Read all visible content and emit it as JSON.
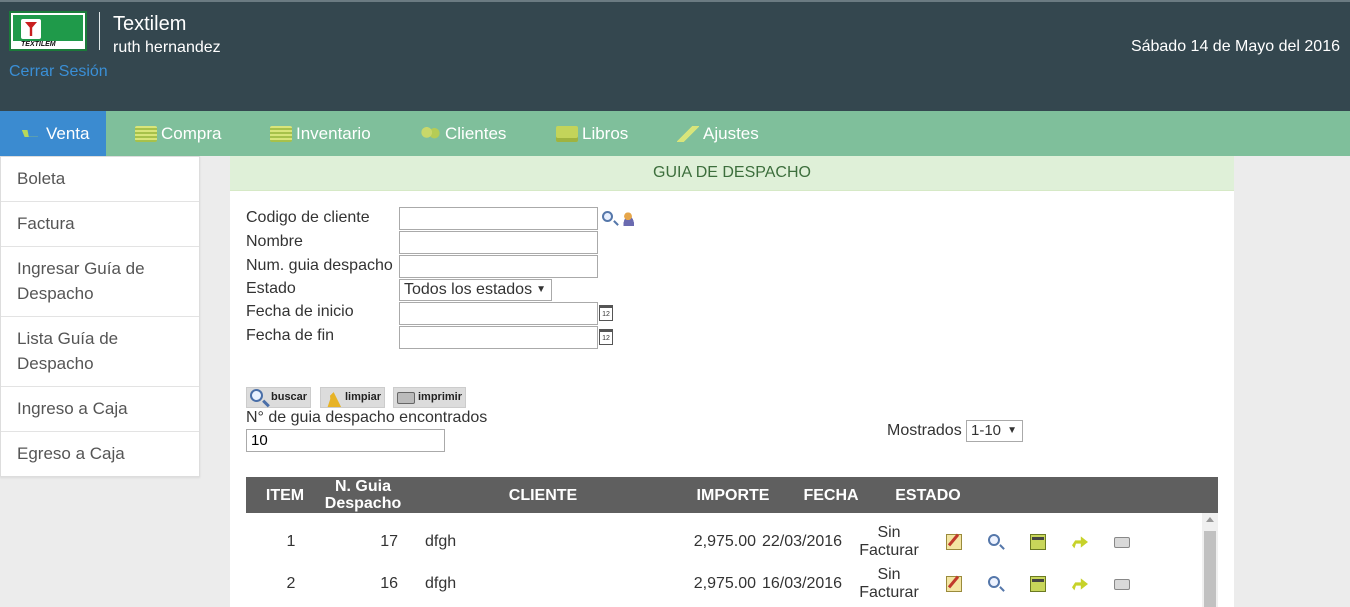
{
  "header": {
    "logo_text": "TEXTILEM",
    "app_title": "Textilem",
    "user_name": "ruth hernandez",
    "logout_label": "Cerrar Sesión",
    "date": "Sábado 14 de Mayo del 2016"
  },
  "nav": {
    "items": [
      {
        "label": "Venta",
        "icon": "cart-icon",
        "active": true
      },
      {
        "label": "Compra",
        "icon": "list-icon"
      },
      {
        "label": "Inventario",
        "icon": "list-icon"
      },
      {
        "label": "Clientes",
        "icon": "users-icon"
      },
      {
        "label": "Libros",
        "icon": "books-icon"
      },
      {
        "label": "Ajustes",
        "icon": "tools-icon"
      }
    ]
  },
  "sidebar": {
    "items": [
      {
        "label": "Boleta"
      },
      {
        "label": "Factura"
      },
      {
        "label": "Ingresar Guía de Despacho"
      },
      {
        "label": "Lista Guía de Despacho"
      },
      {
        "label": "Ingreso a Caja"
      },
      {
        "label": "Egreso a Caja"
      }
    ]
  },
  "panel": {
    "title": "GUIA DE DESPACHO"
  },
  "form": {
    "client_code_label": "Codigo de cliente",
    "client_code_value": "",
    "name_label": "Nombre",
    "name_value": "",
    "guide_num_label": "Num. guia despacho",
    "guide_num_value": "",
    "status_label": "Estado",
    "status_value": "Todos los estados",
    "start_date_label": "Fecha de inicio",
    "start_date_value": "",
    "end_date_label": "Fecha de fin",
    "end_date_value": "",
    "calendar_icon_text": "12"
  },
  "actions": {
    "search_label": "buscar",
    "clear_label": "limpiar",
    "print_label": "imprimir"
  },
  "results": {
    "found_label": "N° de guia despacho encontrados",
    "found_value": "10",
    "shown_label": "Mostrados",
    "shown_value": "1-10"
  },
  "table": {
    "headers": {
      "item": "ITEM",
      "guide": "N. Guia Despacho",
      "client": "CLIENTE",
      "amount": "IMPORTE",
      "date": "FECHA",
      "status": "ESTADO"
    },
    "rows": [
      {
        "item": "1",
        "guide": "17",
        "client": "dfgh",
        "amount": "2,975.00",
        "date": "22/03/2016",
        "status": "Sin Facturar"
      },
      {
        "item": "2",
        "guide": "16",
        "client": "dfgh",
        "amount": "2,975.00",
        "date": "16/03/2016",
        "status": "Sin Facturar"
      }
    ]
  },
  "colors": {
    "header_bg": "#34474f",
    "nav_bg": "#7fbf9b",
    "nav_active": "#3b8bd0",
    "panel_title_bg": "#dff0d8",
    "table_header_bg": "#5f5f5f",
    "link": "#3a8fd6"
  }
}
